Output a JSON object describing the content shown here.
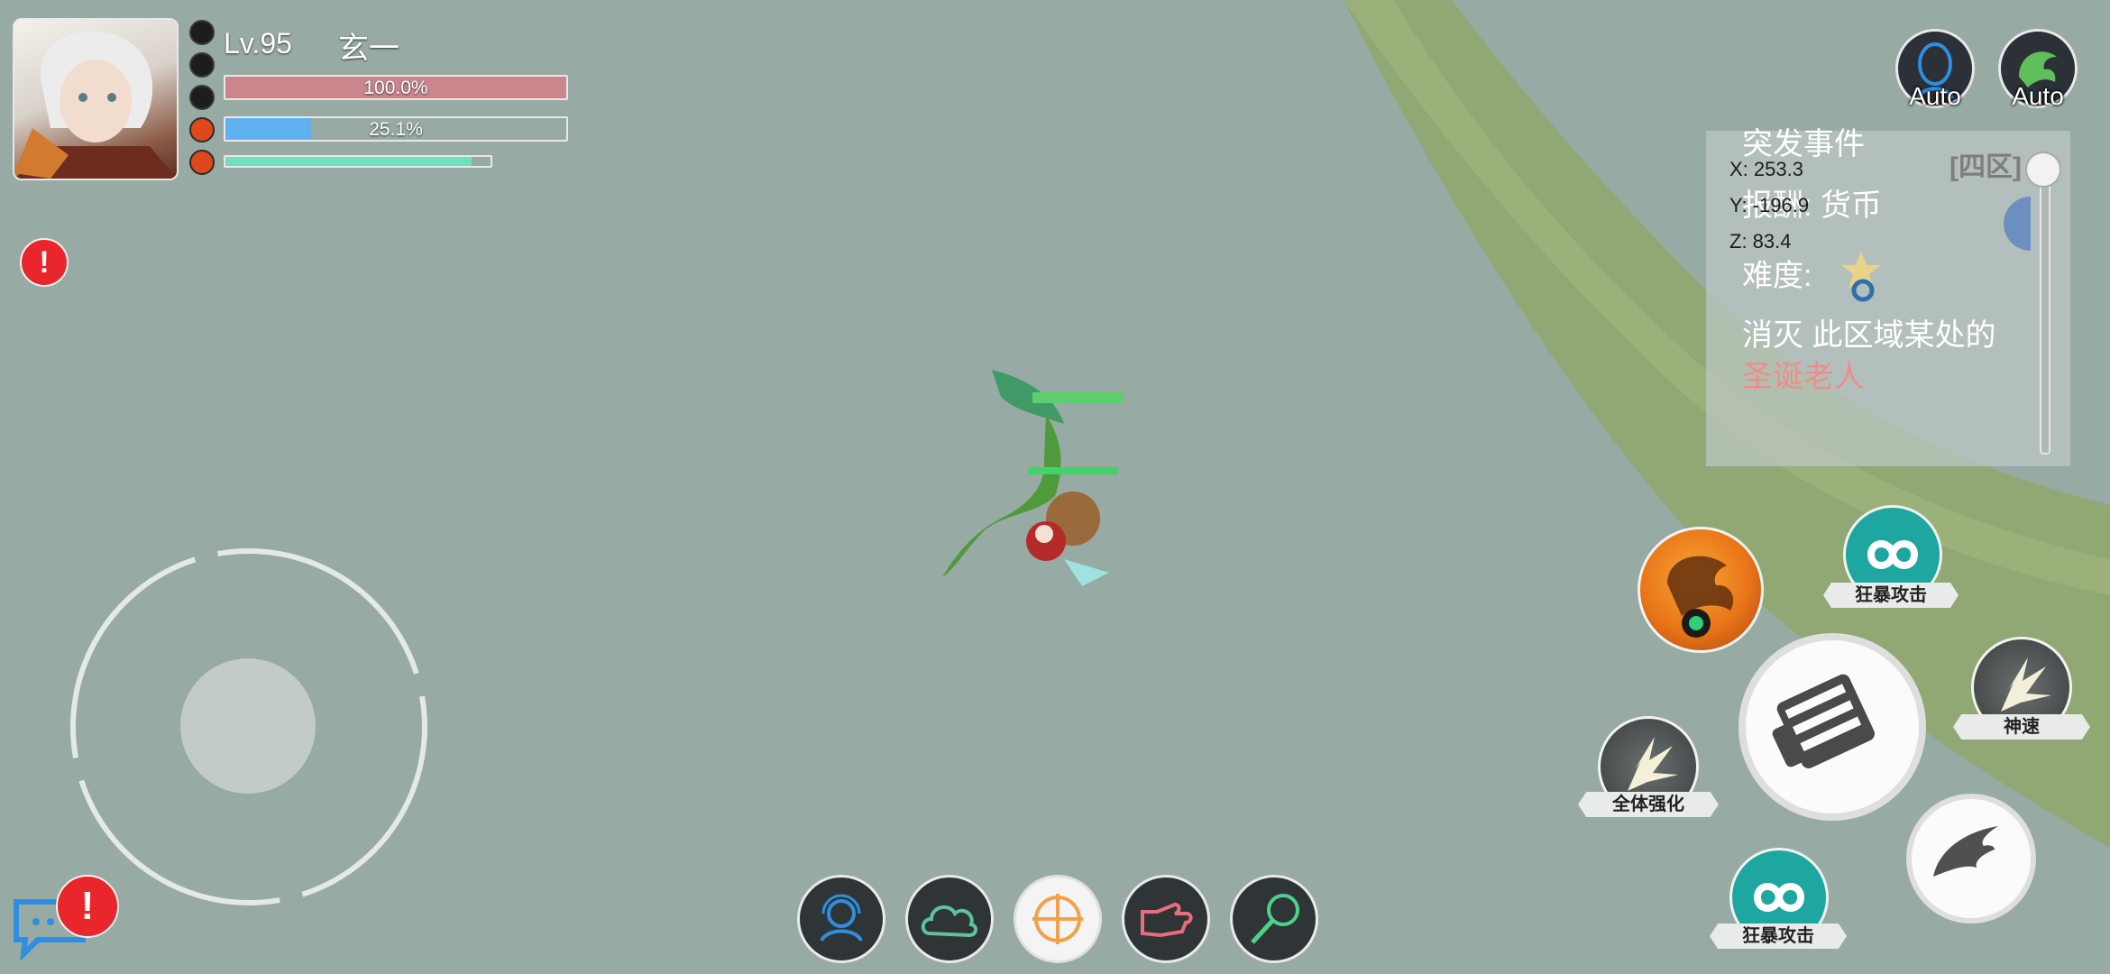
{
  "player": {
    "level": "Lv.95",
    "name": "玄一",
    "hp": {
      "text": "100.0%",
      "fraction": 1.0
    },
    "mp": {
      "text": "25.1%",
      "fraction": 0.251
    },
    "exp": {
      "fraction": 0.93
    }
  },
  "auto_buttons": [
    {
      "label": "Auto"
    },
    {
      "label": "Auto"
    }
  ],
  "coords": {
    "x": "X: 253.3",
    "y": "Y: -196.9",
    "z": "Z: 83.4"
  },
  "event": {
    "title": "突发事件",
    "zone": "[四区]",
    "reward": "报酬:  货币",
    "difficulty": "难度:",
    "desc": "消灭 此区域某处的",
    "target": "圣诞老人"
  },
  "skills": {
    "berserk_1": "狂暴攻击",
    "berserk_2": "狂暴攻击",
    "speed": "神速",
    "buff_all": "全体强化"
  },
  "bottom_menu": [
    "support-icon",
    "cloud-icon",
    "target-icon",
    "gesture-icon",
    "net-icon"
  ],
  "colors": {
    "background": "#97aaa3",
    "grass": "#8fa86c",
    "alert": "#e8262b"
  }
}
